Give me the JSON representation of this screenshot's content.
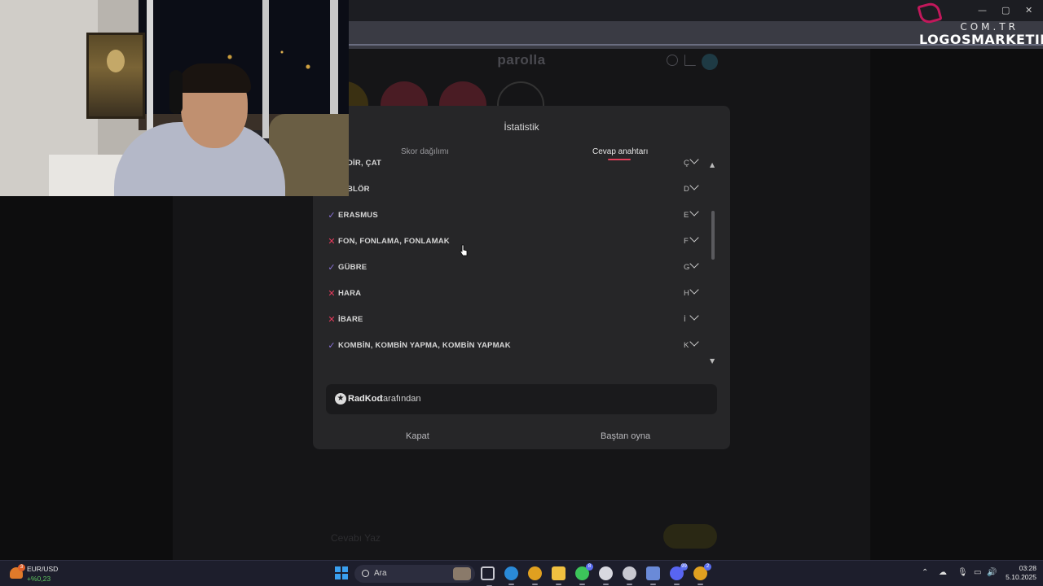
{
  "window": {
    "minimize": "—",
    "maximize": "▢",
    "close": "✕"
  },
  "overlay_logo": {
    "top": "COM.TR",
    "main": "LOGOSMARKETIM"
  },
  "game": {
    "title": "parolla",
    "answer_placeholder": "Cevabı Yaz"
  },
  "modal": {
    "title": "İstatistik",
    "tabs": [
      {
        "label": "Skor dağılımı",
        "active": false
      },
      {
        "label": "Cevap anahtarı",
        "active": true
      }
    ],
    "accent_color": "#e0405a",
    "answers": [
      {
        "text": "DİR, ÇAT",
        "status": "partial",
        "letter": "Ç"
      },
      {
        "text": "BLÖR",
        "status": "partial",
        "letter": "D"
      },
      {
        "text": "ERASMUS",
        "status": "correct",
        "letter": "E"
      },
      {
        "text": "FON, FONLAMA, FONLAMAK",
        "status": "wrong",
        "letter": "F"
      },
      {
        "text": "GÜBRE",
        "status": "correct",
        "letter": "G"
      },
      {
        "text": "HARA",
        "status": "wrong",
        "letter": "H"
      },
      {
        "text": "İBARE",
        "status": "wrong",
        "letter": "İ"
      },
      {
        "text": "KOMBİN, KOMBİN YAPMA, KOMBİN YAPMAK",
        "status": "correct",
        "letter": "K"
      }
    ],
    "author": {
      "name": "RadKod",
      "suffix": "tarafından"
    },
    "buttons": {
      "close": "Kapat",
      "restart": "Baştan oyna"
    }
  },
  "taskbar": {
    "widget": {
      "badge": "3",
      "pair": "EUR/USD",
      "change": "+%0,23"
    },
    "search_placeholder": "Ara",
    "apps": [
      {
        "name": "task-view-icon",
        "color": "#c8c8d0"
      },
      {
        "name": "edge-icon",
        "color": "#2a8ad8"
      },
      {
        "name": "chrome-icon",
        "color": "#e0a020"
      },
      {
        "name": "file-explorer-icon",
        "color": "#f0c040"
      },
      {
        "name": "whatsapp-icon",
        "color": "#3cc45a",
        "badge": "8"
      },
      {
        "name": "steam-icon",
        "color": "#d8d8e0"
      },
      {
        "name": "obs-icon",
        "color": "#c8c8d0"
      },
      {
        "name": "app-icon",
        "color": "#6a8ad8"
      },
      {
        "name": "discord-icon",
        "color": "#5865f2",
        "badge": "99"
      },
      {
        "name": "chrome-active-icon",
        "color": "#e0a020",
        "badge": "2"
      }
    ],
    "tray": {
      "chevron": "⌃",
      "time": "03:28",
      "date": "5.10.2025"
    }
  }
}
